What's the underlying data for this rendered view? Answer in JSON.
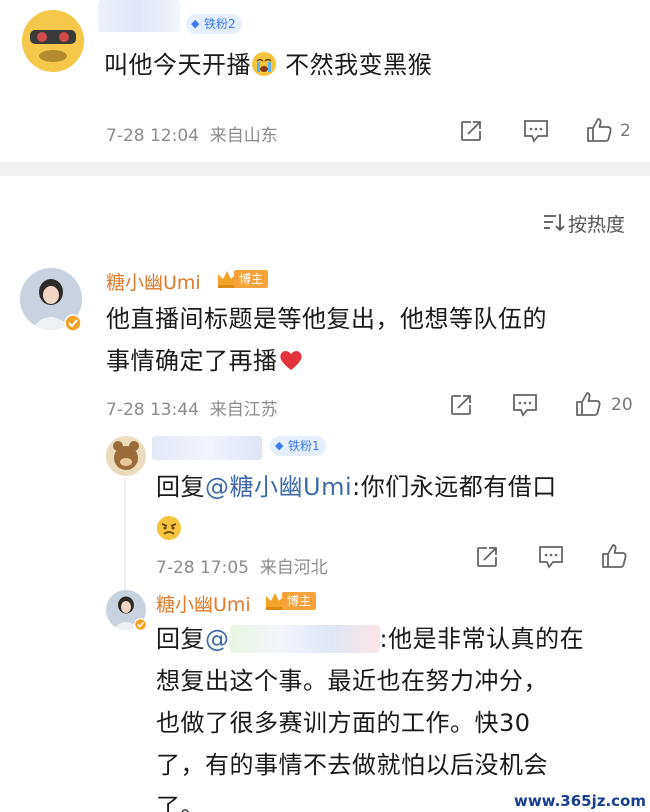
{
  "comment1": {
    "fan_badge": "铁粉2",
    "text": "叫他今天开播",
    "text_after_emoji": " 不然我变黑猴",
    "time": "7-28 12:04",
    "location": "来自山东",
    "like_count": "2"
  },
  "sort": {
    "label": "按热度"
  },
  "comment2": {
    "username": "糖小幽Umi",
    "host_badge": "博主",
    "text_line1": "他直播间标题是等他复出，他想等队伍的",
    "text_line2": "事情确定了再播",
    "time": "7-28 13:44",
    "location": "来自江苏",
    "like_count": "20"
  },
  "reply1": {
    "fan_badge": "铁粉1",
    "reply_prefix": "回复",
    "mention": "@糖小幽Umi",
    "text": ":你们永远都有借口",
    "time": "7-28 17:05",
    "location": "来自河北"
  },
  "reply2": {
    "username": "糖小幽Umi",
    "host_badge": "博主",
    "reply_prefix": "回复",
    "mention_at": "@",
    "text_line1": ":他是非常认真的在",
    "text_line2": "想复出这个事。最近也在努力冲分，",
    "text_line3": "也做了很多赛训方面的工作。快30",
    "text_line4": "了，有的事情不去做就怕以后没机会",
    "text_line5": "了。"
  },
  "watermark": "www.365jz.com",
  "colors": {
    "username": "#e07a2c",
    "mention": "#3f6aa7",
    "fan_badge": "#3d7cf0",
    "host_badge": "#f7a23a",
    "meta": "#8c8c8c"
  },
  "icons": [
    "share-icon",
    "comment-icon",
    "like-icon",
    "sort-icon",
    "crown-icon",
    "heart-emoji",
    "crying-emoji",
    "angry-emoji"
  ]
}
